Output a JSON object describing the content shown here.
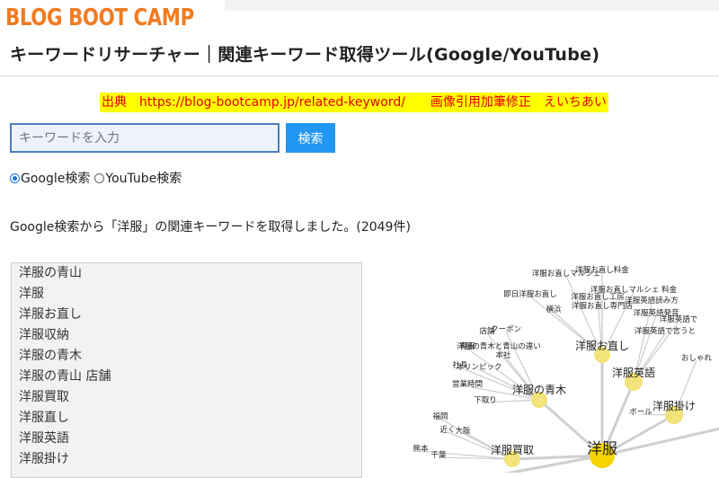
{
  "header": {
    "logo_text": "BLOG BOOT CAMP",
    "page_title": "キーワードリサーチャー｜関連キーワード取得ツール(Google/YouTube)"
  },
  "source_note": "出典　https://blog-bootcamp.jp/related-keyword/　　画像引用加筆修正　えいちあい",
  "search": {
    "placeholder": "キーワードを入力",
    "value": "",
    "button_label": "検索"
  },
  "engines": [
    {
      "label": "Google検索",
      "selected": true
    },
    {
      "label": "YouTube検索",
      "selected": false
    }
  ],
  "result_message": "Google検索から「洋服」の関連キーワードを取得しました。(2049件)",
  "keywords": [
    "洋服の青山",
    "洋服",
    "洋服お直し",
    "洋服収納",
    "洋服の青木",
    "洋服の青山 店舗",
    "洋服買取",
    "洋服直し",
    "洋服英語",
    "洋服掛け"
  ],
  "graph": {
    "center": "洋服",
    "hubs": [
      "洋服お直し",
      "洋服英語",
      "洋服の青木",
      "洋服掛け",
      "洋服買取",
      "洋服"
    ],
    "leaves": [
      "洋服お直しマルシェ",
      "洋服お直し料金",
      "洋服お直しマルシェ 料金",
      "即日洋服お直し",
      "洋服お直し工房",
      "横浜",
      "洋服お直し専門店",
      "洋服英語読み方",
      "洋服英語発音",
      "洋服英語で",
      "洋服英語で言うと",
      "店舗",
      "クーポン",
      "喪服",
      "洋服の青木と青山の違い",
      "本社",
      "社長",
      "オリンピック",
      "営業時間",
      "下取り",
      "おしゃれ",
      "ボール",
      "福岡",
      "近く",
      "大阪",
      "熊本",
      "千葉"
    ],
    "colors": {
      "hub": "#f2e37a",
      "center": "#f5d400",
      "edge": "#cfcfcf",
      "text": "#222222"
    }
  },
  "colors": {
    "accent": "#f07b22",
    "button": "#2196f3",
    "highlight": "#ffff00",
    "note_text": "#e30000"
  }
}
